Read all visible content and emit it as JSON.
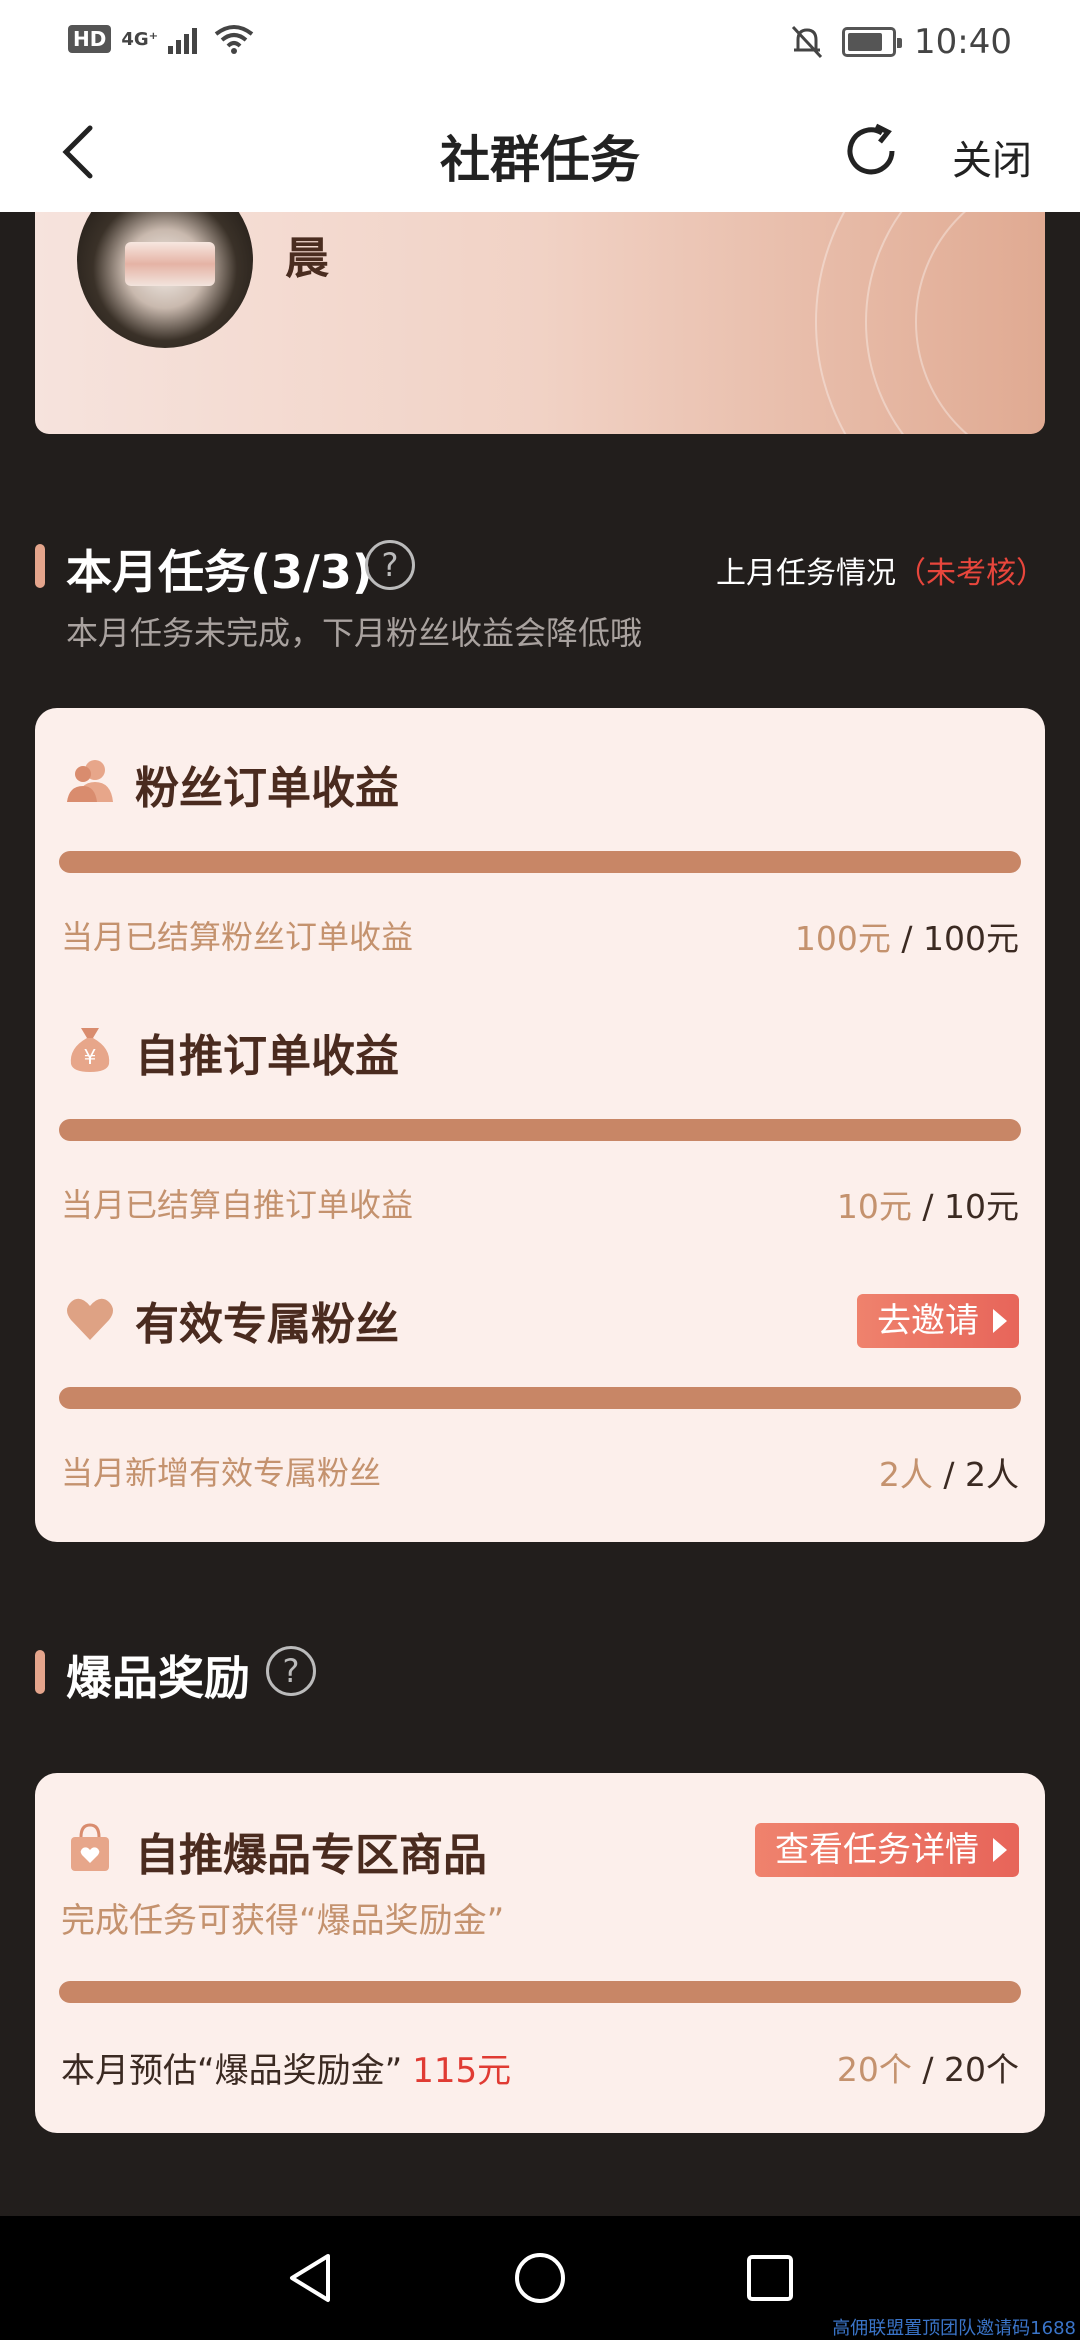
{
  "status": {
    "hd": "HD",
    "network": "4G⁺",
    "time": "10:40"
  },
  "nav": {
    "title": "社群任务",
    "close_label": "关闭"
  },
  "profile": {
    "name": "晨"
  },
  "month_tasks": {
    "title": "本月任务(3/3)",
    "help": "?",
    "hint": "本月任务未完成，下月粉丝收益会降低哦",
    "last_month_label": "上月任务情况",
    "last_month_status": "（未考核）",
    "tasks": [
      {
        "icon": "fans-icon",
        "title": "粉丝订单收益",
        "desc": "当月已结算粉丝订单收益",
        "current": "100元",
        "separator": " / ",
        "target": "100元",
        "progress": 1.0
      },
      {
        "icon": "money-bag-icon",
        "title": "自推订单收益",
        "desc": "当月已结算自推订单收益",
        "current": "10元",
        "separator": " / ",
        "target": "10元",
        "progress": 1.0
      },
      {
        "icon": "heart-icon",
        "title": "有效专属粉丝",
        "desc": "当月新增有效专属粉丝",
        "current": "2人",
        "separator": " / ",
        "target": "2人",
        "progress": 1.0,
        "action": "去邀请"
      }
    ]
  },
  "hot_reward": {
    "title": "爆品奖励",
    "help": "?",
    "task": {
      "icon": "shopping-bag-icon",
      "title": "自推爆品专区商品",
      "action": "查看任务详情",
      "subtitle": "完成任务可获得“爆品奖励金”",
      "estimate_label": "本月预估“爆品奖励金”",
      "estimate_value": "115元",
      "current": "20个",
      "separator": " / ",
      "target": "20个",
      "progress": 1.0
    }
  },
  "watermark": "高佣联盟置顶团队邀请码1688",
  "colors": {
    "accent": "#e7655a",
    "progress": "#c88666",
    "card_bg": "#fcefeb",
    "page_bg": "#221e1c"
  }
}
